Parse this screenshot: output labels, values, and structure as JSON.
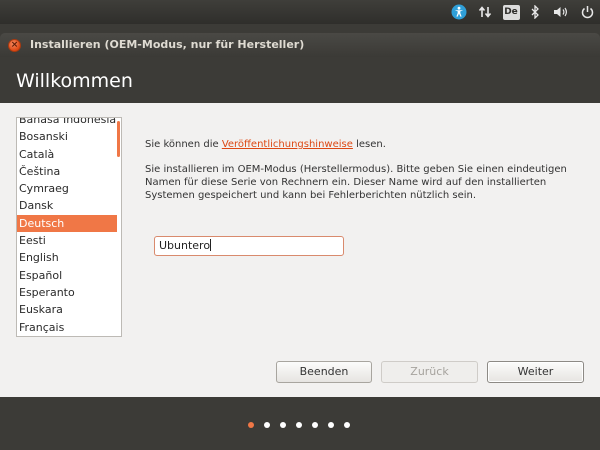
{
  "system_panel": {
    "keyboard_layout": "De",
    "icons": [
      "accessibility-icon",
      "network-icon",
      "keyboard-layout-icon",
      "bluetooth-icon",
      "volume-icon",
      "power-icon"
    ]
  },
  "window": {
    "title": "Installieren (OEM-Modus, nur für Hersteller)",
    "close_symbol": "×"
  },
  "page": {
    "title": "Willkommen"
  },
  "languages": [
    {
      "label": "Bahasa Indonesia",
      "selected": false
    },
    {
      "label": "Bosanski",
      "selected": false
    },
    {
      "label": "Català",
      "selected": false
    },
    {
      "label": "Čeština",
      "selected": false
    },
    {
      "label": "Cymraeg",
      "selected": false
    },
    {
      "label": "Dansk",
      "selected": false
    },
    {
      "label": "Deutsch",
      "selected": true
    },
    {
      "label": "Eesti",
      "selected": false
    },
    {
      "label": "English",
      "selected": false
    },
    {
      "label": "Español",
      "selected": false
    },
    {
      "label": "Esperanto",
      "selected": false
    },
    {
      "label": "Euskara",
      "selected": false
    },
    {
      "label": "Français",
      "selected": false
    }
  ],
  "release_notes": {
    "prefix": "Sie können die ",
    "link": "Veröffentlichungshinweise",
    "suffix": " lesen."
  },
  "oem_text": {
    "line1": "Sie installieren im OEM-Modus (Herstellermodus). Bitte geben Sie einen eindeutigen",
    "line2": "Namen für diese Serie von Rechnern ein. Dieser Name wird auf den installierten",
    "line3": "Systemen gespeichert und kann bei Fehlerberichten nützlich sein."
  },
  "name_field": {
    "value": "Ubuntero"
  },
  "buttons": {
    "quit": "Beenden",
    "back": "Zurück",
    "next": "Weiter"
  },
  "progress": {
    "total_steps": 7,
    "current_step": 1
  },
  "colors": {
    "accent": "#f07746",
    "panel": "#3c3b37",
    "content_bg": "#f2f1f0"
  }
}
